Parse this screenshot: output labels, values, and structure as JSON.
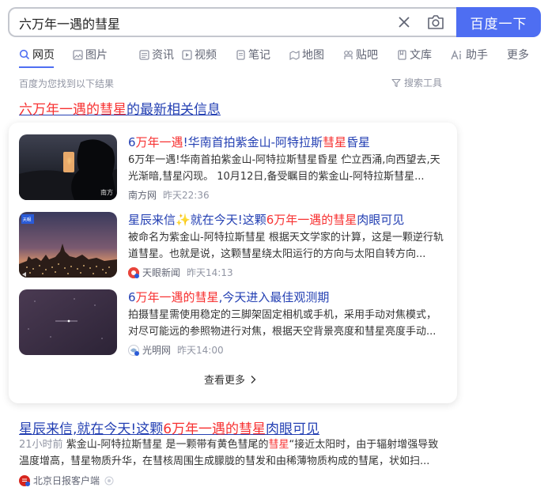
{
  "search": {
    "query": "六万年一遇的彗星",
    "button_label": "百度一下"
  },
  "tabs": [
    {
      "label": "网页",
      "icon": "search-icon"
    },
    {
      "label": "图片",
      "icon": "image-icon"
    },
    {
      "label": "资讯",
      "icon": "news-icon"
    },
    {
      "label": "视频",
      "icon": "video-icon"
    },
    {
      "label": "笔记",
      "icon": "note-icon"
    },
    {
      "label": "地图",
      "icon": "map-icon"
    },
    {
      "label": "贴吧",
      "icon": "tieba-icon"
    },
    {
      "label": "文库",
      "icon": "wenku-icon"
    },
    {
      "label": "助手",
      "icon": "ai-icon"
    },
    {
      "label": "更多",
      "icon": ""
    }
  ],
  "results_info": "百度为您找到以下结果",
  "tools_label": "搜索工具",
  "news_section": {
    "title_hl": "六万年一遇的彗星",
    "title_rest": "的最新相关信息",
    "items": [
      {
        "title_parts": [
          "6",
          "万年一遇",
          "!华南首拍紫金山-阿特拉斯",
          "彗星",
          "昏星"
        ],
        "desc": "6万年一遇!华南首拍紫金山-阿特拉斯彗星昏星 伫立西涌,向西望去,天光渐暗,彗星闪现。 10月12日,备受瞩目的紫金山-阿特拉斯彗星...",
        "source": "南方网",
        "time": "昨天22:36"
      },
      {
        "title_parts": [
          "星辰来信",
          "✨",
          "就在今天!这颗",
          "6万年一遇的彗星",
          "肉眼可见"
        ],
        "desc": "被命名为紫金山-阿特拉斯彗星 根据天文学家的计算，这是一颗逆行轨道彗星。也就是说，这颗彗星绕太阳运行的方向与太阳自转方向...",
        "source": "天眼新闻",
        "time": "昨天14:13"
      },
      {
        "title_parts": [
          "6",
          "万年一遇的彗星",
          ",今天进入最佳观测期"
        ],
        "desc": "拍摄彗星需使用稳定的三脚架固定相机或手机，采用手动对焦模式，对尽可能远的参照物进行对焦，根据天空背景亮度和彗星亮度手动...",
        "source": "光明网",
        "time": "昨天14:00"
      }
    ],
    "more_label": "查看更多"
  },
  "result2": {
    "title_parts": [
      "星辰来信,就在今天!这颗",
      "6万年一遇的彗星",
      "肉眼可见"
    ],
    "time": "21小时前",
    "desc_parts": [
      "紫金山-阿特拉斯彗星 是一颗带有黄色彗尾的",
      "彗星",
      "“接近太阳时，由于辐射增强导致温度增高，彗星物质升华，在彗核周围生成朦胧的彗发和由稀薄物质构成的彗尾，状如扫..."
    ],
    "source": "北京日报客户端"
  },
  "colors": {
    "accent": "#4e6ef2",
    "link": "#2440b3",
    "highlight": "#f73131",
    "muted": "#9195a3"
  }
}
